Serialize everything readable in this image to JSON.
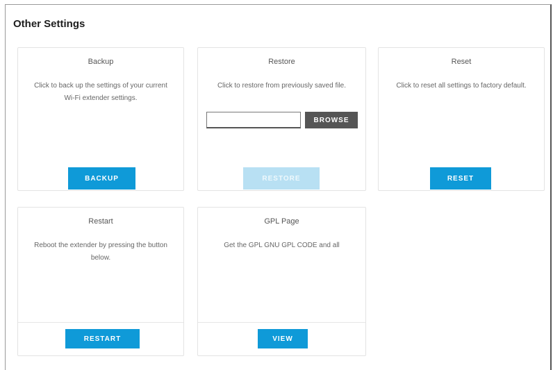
{
  "page": {
    "title": "Other Settings"
  },
  "cards": {
    "backup": {
      "title": "Backup",
      "description": "Click to back up the settings of your current Wi-Fi extender settings.",
      "button": "BACKUP"
    },
    "restore": {
      "title": "Restore",
      "description": "Click to restore from previously saved file.",
      "input_value": "",
      "browse_button": "BROWSE",
      "button": "RESTORE"
    },
    "reset": {
      "title": "Reset",
      "description": "Click to reset all settings to factory default.",
      "button": "RESET"
    },
    "restart": {
      "title": "Restart",
      "description": "Reboot the extender by pressing the button below.",
      "button": "RESTART"
    },
    "gpl": {
      "title": "GPL Page",
      "description": "Get the GPL GNU GPL CODE and all",
      "button": "VIEW"
    }
  },
  "colors": {
    "accent": "#0f9ad8",
    "disabled": "#b8e0f3",
    "dark_button": "#555555"
  }
}
